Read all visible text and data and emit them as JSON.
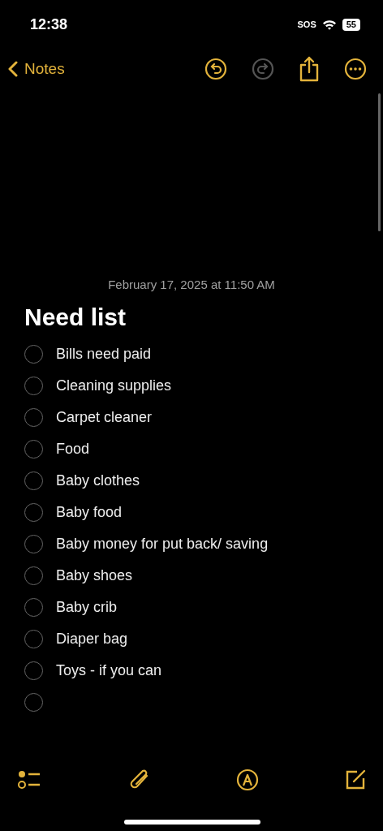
{
  "status_bar": {
    "time": "12:38",
    "carrier": "SOS",
    "battery": "55"
  },
  "nav": {
    "back_label": "Notes",
    "actions": [
      {
        "kind": "undo",
        "disabled": false
      },
      {
        "kind": "redo",
        "disabled": true
      },
      {
        "kind": "share",
        "disabled": false
      },
      {
        "kind": "more",
        "disabled": false
      }
    ]
  },
  "note": {
    "date": "February 17, 2025 at 11:50 AM",
    "title": "Need list",
    "checklist": [
      {
        "text": "Bills need paid",
        "checked": false
      },
      {
        "text": "Cleaning supplies",
        "checked": false
      },
      {
        "text": "Carpet cleaner",
        "checked": false
      },
      {
        "text": "Food",
        "checked": false
      },
      {
        "text": "Baby clothes",
        "checked": false
      },
      {
        "text": "Baby food",
        "checked": false
      },
      {
        "text": "Baby money for put back/ saving",
        "checked": false
      },
      {
        "text": "Baby shoes",
        "checked": false
      },
      {
        "text": "Baby crib",
        "checked": false
      },
      {
        "text": "Diaper bag",
        "checked": false
      },
      {
        "text": "Toys - if you can",
        "checked": false
      },
      {
        "checked": false
      }
    ]
  },
  "toolbar": [
    {
      "kind": "checklist"
    },
    {
      "kind": "attach"
    },
    {
      "kind": "markup"
    },
    {
      "kind": "compose"
    }
  ]
}
